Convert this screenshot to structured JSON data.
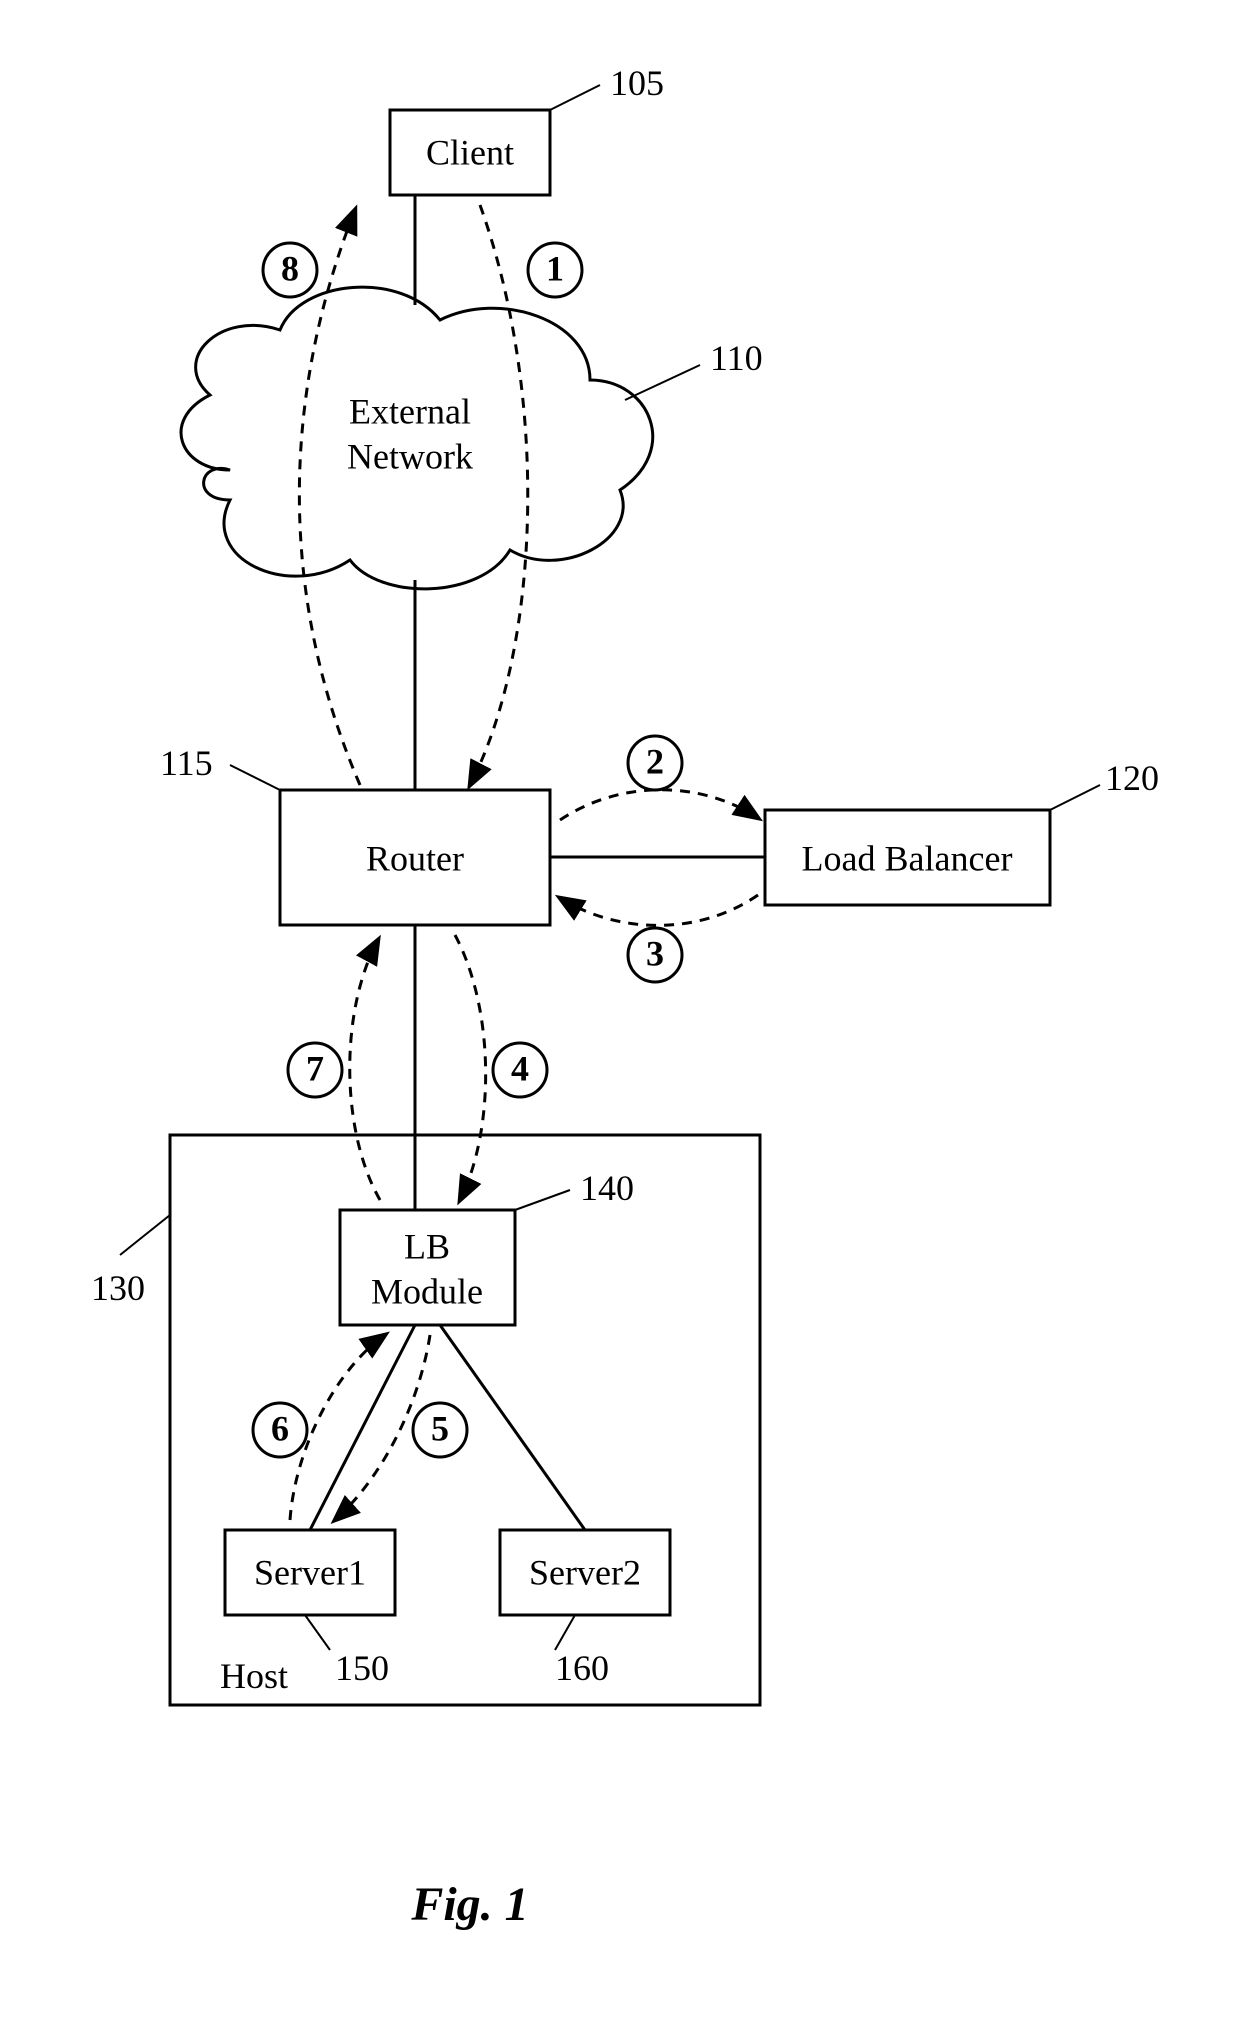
{
  "figure_label": "Fig. 1",
  "nodes": {
    "client": {
      "label": "Client",
      "ref": "105"
    },
    "network": {
      "label1": "External",
      "label2": "Network",
      "ref": "110"
    },
    "router": {
      "label": "Router",
      "ref": "115"
    },
    "load_balancer": {
      "label": "Load Balancer",
      "ref": "120"
    },
    "host": {
      "label": "Host",
      "ref": "130"
    },
    "lb_module": {
      "label1": "LB",
      "label2": "Module",
      "ref": "140"
    },
    "server1": {
      "label": "Server1",
      "ref": "150"
    },
    "server2": {
      "label": "Server2",
      "ref": "160"
    }
  },
  "steps": {
    "s1": "1",
    "s2": "2",
    "s3": "3",
    "s4": "4",
    "s5": "5",
    "s6": "6",
    "s7": "7",
    "s8": "8"
  }
}
